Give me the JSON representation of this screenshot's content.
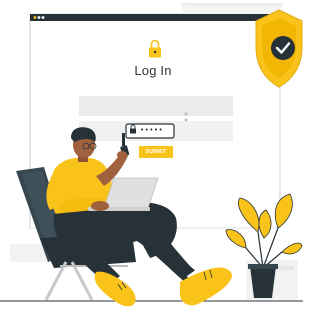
{
  "login_panel": {
    "title": "Log In",
    "password_mask": "•••••",
    "submit_label": "SUBMIT"
  },
  "icons": {
    "padlock": "padlock-icon",
    "security_shield": "shield-check-icon"
  },
  "colors": {
    "accent_yellow": "#F9C31A",
    "dark": "#263238",
    "window_grey": "#EBEBEB",
    "skin": "#A0613F"
  }
}
